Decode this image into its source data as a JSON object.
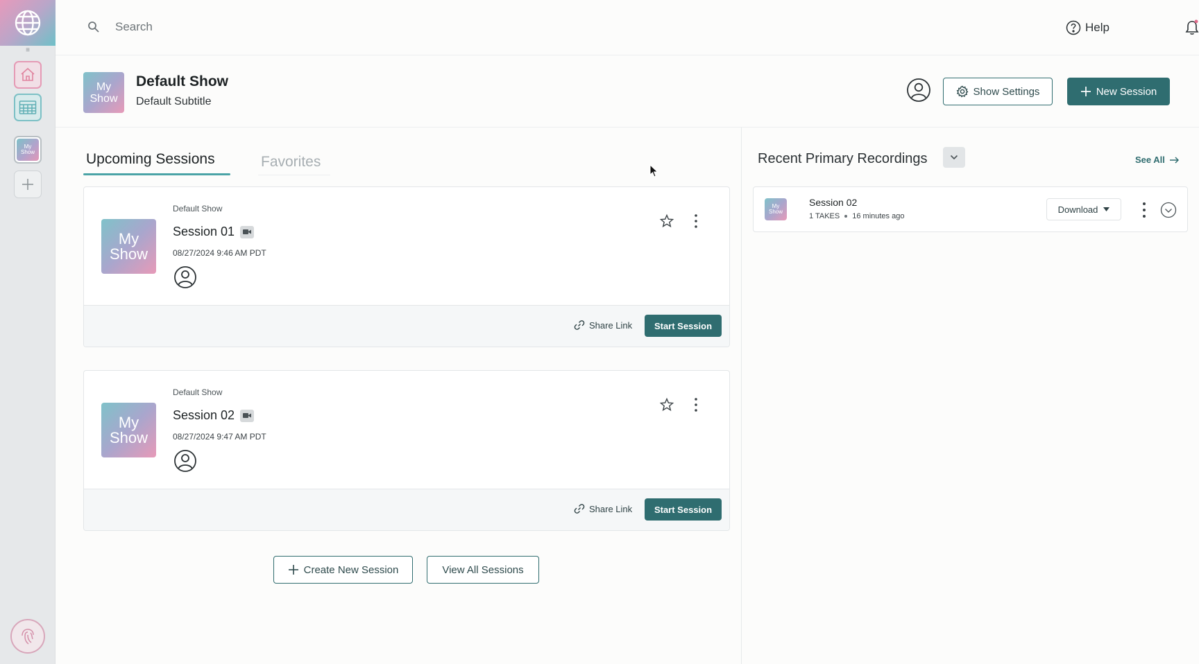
{
  "rail": {
    "logo_icon": "globe-icon",
    "grip_icon": "drag-handle-icon",
    "home_icon": "home-icon",
    "calendar_icon": "calendar-icon",
    "show_thumb_label": "My Show",
    "add_icon": "plus-icon",
    "bottom_icon": "fingerprint-icon",
    "colors": {
      "home": "#e59ab5",
      "calendar": "#7cc0c5"
    }
  },
  "topbar": {
    "search_placeholder": "Search",
    "search_value": "",
    "help_label": "Help",
    "bell_icon": "bell-icon",
    "avatar_icon": "user-circle-icon"
  },
  "show": {
    "thumb_label": "My Show",
    "title": "Default Show",
    "subtitle": "Default Subtitle",
    "settings_label": "Show Settings",
    "new_session_label": "New Session",
    "accent": "#2f6d70"
  },
  "tabs": [
    {
      "label": "Upcoming Sessions",
      "active": true
    },
    {
      "label": "Favorites",
      "active": false
    }
  ],
  "sessions": [
    {
      "show_name": "Default Show",
      "thumb_label": "My Show",
      "title": "Session 01",
      "date": "08/27/2024 9:46 AM PDT",
      "share_label": "Share Link",
      "start_label": "Start Session"
    },
    {
      "show_name": "Default Show",
      "thumb_label": "My Show",
      "title": "Session 02",
      "date": "08/27/2024 9:47 AM PDT",
      "share_label": "Share Link",
      "start_label": "Start Session"
    }
  ],
  "session_actions": {
    "create_label": "Create New Session",
    "view_all_label": "View All Sessions"
  },
  "recordings": {
    "title": "Recent Primary Recordings",
    "see_all_label": "See All",
    "items": [
      {
        "thumb_label": "My Show",
        "title": "Session 02",
        "takes": "1 TAKES",
        "age": "16 minutes ago",
        "download_label": "Download"
      }
    ]
  }
}
